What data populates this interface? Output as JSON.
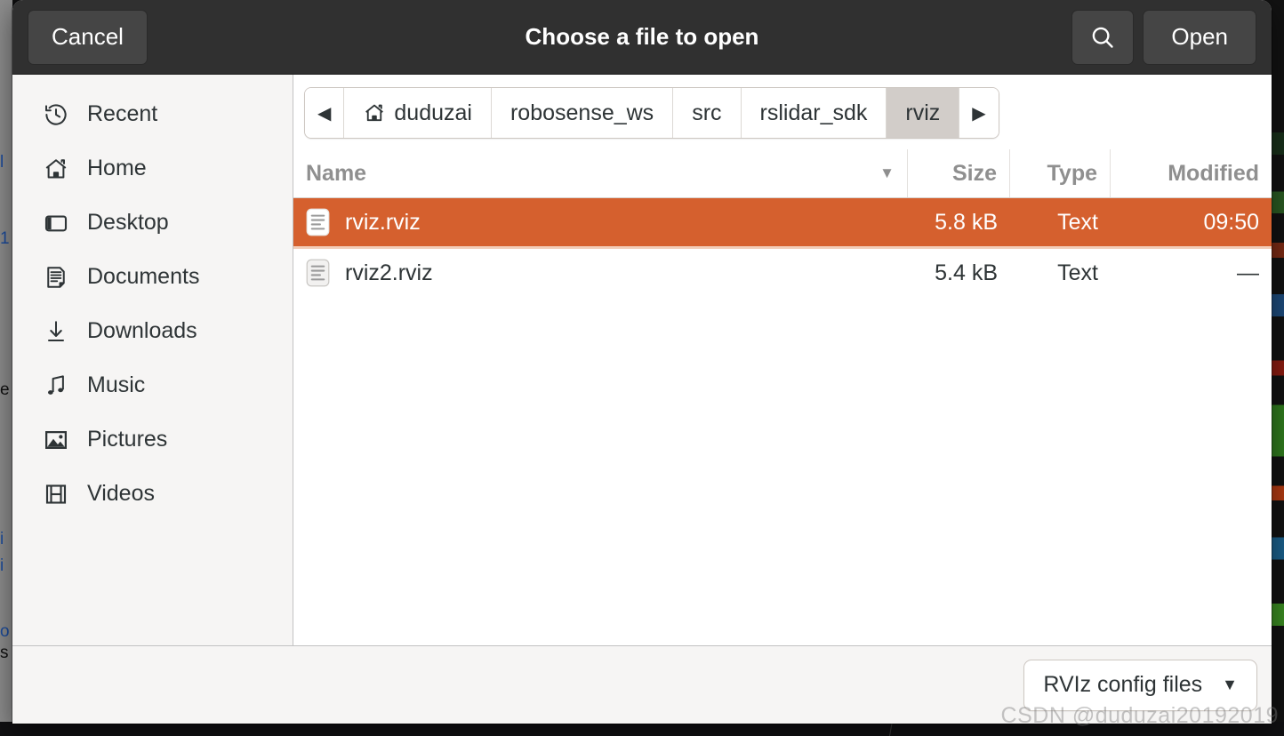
{
  "header": {
    "cancel_label": "Cancel",
    "title": "Choose a file to open",
    "search_icon": "search-icon",
    "open_label": "Open"
  },
  "sidebar": {
    "items": [
      {
        "label": "Recent",
        "icon": "clock-history-icon"
      },
      {
        "label": "Home",
        "icon": "home-icon"
      },
      {
        "label": "Desktop",
        "icon": "desktop-icon"
      },
      {
        "label": "Documents",
        "icon": "documents-icon"
      },
      {
        "label": "Downloads",
        "icon": "download-arrow-icon"
      },
      {
        "label": "Music",
        "icon": "music-note-icon"
      },
      {
        "label": "Pictures",
        "icon": "picture-icon"
      },
      {
        "label": "Videos",
        "icon": "film-strip-icon"
      }
    ]
  },
  "pathbar": {
    "back_arrow": "◀",
    "forward_arrow": "▶",
    "crumbs": [
      {
        "label": "duduzai",
        "icon": "home-icon",
        "active": false
      },
      {
        "label": "robosense_ws",
        "icon": "",
        "active": false
      },
      {
        "label": "src",
        "icon": "",
        "active": false
      },
      {
        "label": "rslidar_sdk",
        "icon": "",
        "active": false
      },
      {
        "label": "rviz",
        "icon": "",
        "active": true
      }
    ]
  },
  "file_list": {
    "columns": {
      "name": "Name",
      "size": "Size",
      "type": "Type",
      "modified": "Modified"
    },
    "sort_arrow": "▼",
    "rows": [
      {
        "name": "rviz.rviz",
        "size": "5.8 kB",
        "type": "Text",
        "modified": "09:50",
        "selected": true
      },
      {
        "name": "rviz2.rviz",
        "size": "5.4 kB",
        "type": "Text",
        "modified": "—",
        "selected": false
      }
    ]
  },
  "actionbar": {
    "filter_label": "RVIz config files",
    "filter_arrow": "▼"
  },
  "watermark": {
    "text": "CSDN @duduzai20192019"
  },
  "colors": {
    "headerbar_bg": "#303030",
    "selection_orange": "#d5602e",
    "sidebar_bg": "#f6f5f4",
    "content_bg": "#ffffff",
    "pathbar_active": "#d2cdc9",
    "column_header_text": "#8f8f8f"
  }
}
